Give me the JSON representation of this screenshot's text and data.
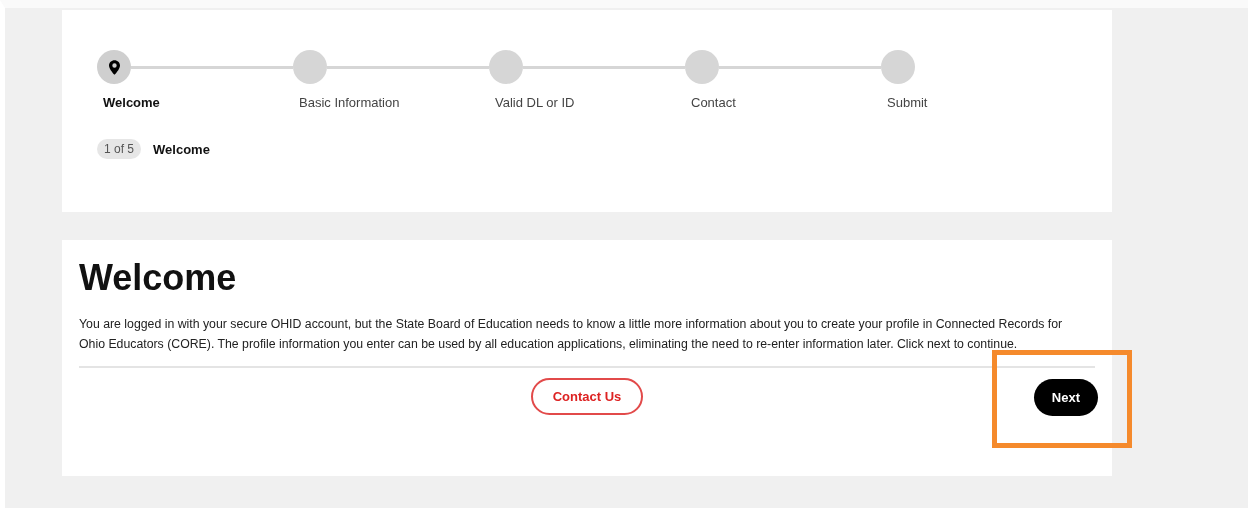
{
  "steps": [
    {
      "label": "Welcome",
      "selected": true
    },
    {
      "label": "Basic Information",
      "selected": false
    },
    {
      "label": "Valid DL or ID",
      "selected": false
    },
    {
      "label": "Contact",
      "selected": false
    },
    {
      "label": "Submit",
      "selected": false
    }
  ],
  "progress": {
    "count": "1 of 5",
    "current": "Welcome"
  },
  "heading": "Welcome",
  "intro": "You are logged in with your secure OHID account, but the State Board of Education needs to know a little more information about you to create your profile in Connected Records for Ohio Educators (CORE). The profile information you enter can be used by all education applications, eliminating the need to re-enter information later. Click next to continue.",
  "buttons": {
    "contact": "Contact Us",
    "next": "Next"
  }
}
